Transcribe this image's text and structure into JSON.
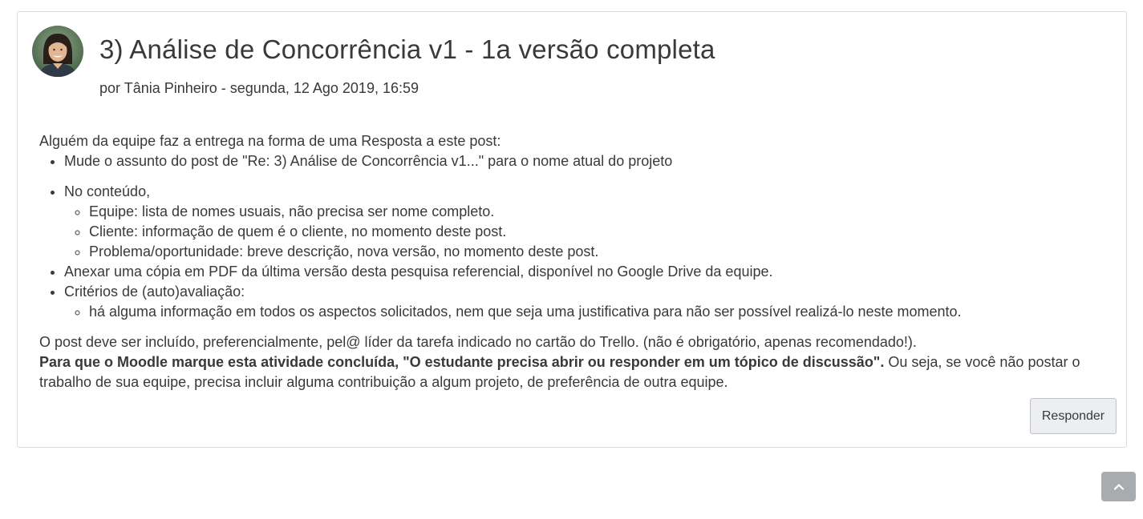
{
  "post": {
    "subject": "3) Análise de Concorrência v1 - 1a versão completa",
    "by_prefix": "por",
    "author": "Tânia Pinheiro",
    "date_sep": " - ",
    "date": "segunda, 12 Ago 2019, 16:59",
    "intro": "Alguém da equipe faz a entrega na forma de uma Resposta a este post:",
    "bullets": {
      "b1": "Mude o assunto do post de \"Re: 3) Análise de Concorrência v1...\" para o nome atual do projeto",
      "b2": "No conteúdo,",
      "b2_sub": [
        "Equipe: lista de nomes usuais, não precisa ser nome completo.",
        "Cliente: informação de quem é o cliente, no momento deste post.",
        "Problema/oportunidade: breve descrição, nova versão, no momento deste post."
      ],
      "b3": "Anexar uma cópia em PDF da última versão desta pesquisa referencial, disponível no Google Drive da equipe.",
      "b4": "Critérios de (auto)avaliação:",
      "b4_sub": [
        "há alguma informação em todos os aspectos solicitados, nem que seja uma justificativa para não ser possível realizá-lo neste momento."
      ]
    },
    "paragraph1": "O post deve ser incluído, preferencialmente, pel@ líder da tarefa indicado no cartão do Trello. (não é obrigatório, apenas recomendado!).",
    "paragraph2_bold": "Para que o Moodle marque esta atividade concluída, \"O estudante precisa abrir ou responder em um tópico de discussão\".",
    "paragraph2_rest": " Ou seja, se você não postar o trabalho de sua equipe, precisa incluir alguma contribuição a algum projeto, de preferência de outra equipe.",
    "reply_label": "Responder"
  },
  "icons": {
    "avatar": "user-photo",
    "back_to_top": "chevron-up-icon"
  },
  "colors": {
    "text": "#373a3c",
    "border": "#dcdcdc",
    "button_bg": "#eceeef",
    "back_to_top_bg": "#a9acae"
  }
}
